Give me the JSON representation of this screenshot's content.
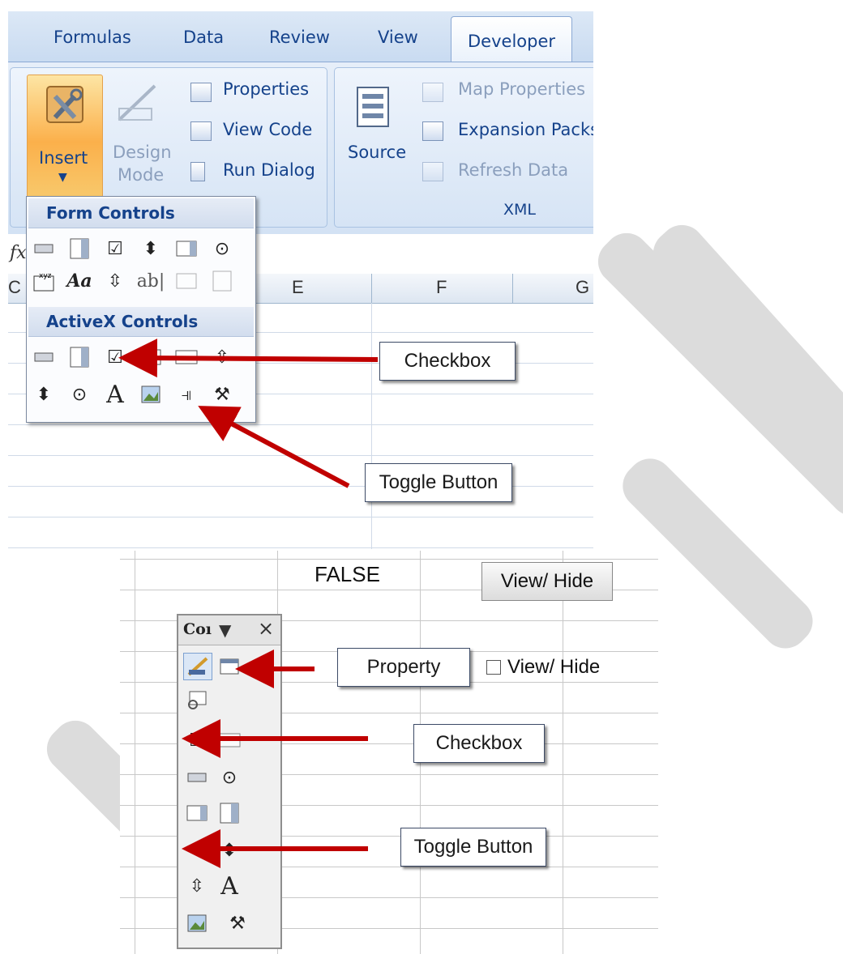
{
  "ribbon": {
    "tabs": [
      "Formulas",
      "Data",
      "Review",
      "View",
      "Developer"
    ],
    "active_tab": "Developer",
    "insert_label": "Insert",
    "design_mode_label": [
      "Design",
      "Mode"
    ],
    "properties_label": "Properties",
    "view_code_label": "View Code",
    "run_dialog_label": "Run Dialog",
    "source_label": "Source",
    "map_properties_label": "Map Properties",
    "expansion_packs_label": "Expansion Packs",
    "refresh_data_label": "Refresh Data",
    "xml_group_label": "XML",
    "formula_bar_fx": "fx",
    "columns": [
      "C",
      "E",
      "F",
      "G"
    ]
  },
  "insert_dropdown": {
    "form_controls_heading": "Form Controls",
    "activex_controls_heading": "ActiveX Controls",
    "form_row2_text": [
      "Aa",
      "ab|"
    ],
    "activex_row2_text": [
      "A"
    ]
  },
  "callouts": {
    "top_checkbox": "Checkbox",
    "top_toggle": "Toggle Button",
    "bottom_property": "Property",
    "bottom_checkbox": "Checkbox",
    "bottom_toggle": "Toggle Button"
  },
  "sheet": {
    "cell_value": "FALSE",
    "view_hide_button": "View/ Hide",
    "view_hide_checkbox": "View/ Hide"
  },
  "toolbox": {
    "title": "Coı",
    "dropdown_glyph": "▼",
    "close_glyph": "×"
  },
  "colors": {
    "arrow": "#c00000",
    "ribbon_text": "#15428b",
    "insert_highlight": "#fbb04b"
  }
}
